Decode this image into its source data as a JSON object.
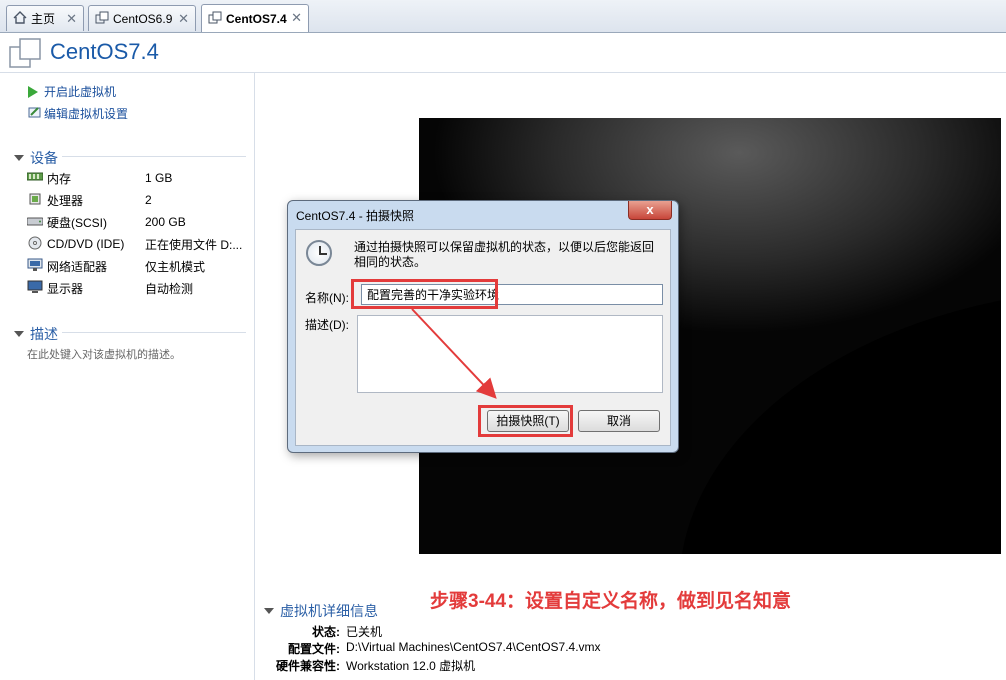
{
  "tabs": [
    {
      "label": "主页",
      "icon": "home-icon"
    },
    {
      "label": "CentOS6.9",
      "icon": "vm-icon"
    },
    {
      "label": "CentOS7.4",
      "icon": "vm-icon",
      "active": true
    }
  ],
  "tab_close_glyph": "✕",
  "header": {
    "title": "CentOS7.4"
  },
  "actions": {
    "power_on": "开启此虚拟机",
    "edit_settings": "编辑虚拟机设置"
  },
  "devices": {
    "section_title": "设备",
    "items": [
      {
        "name": "内存",
        "value": "1 GB",
        "icon": "memory-icon"
      },
      {
        "name": "处理器",
        "value": "2",
        "icon": "cpu-icon"
      },
      {
        "name": "硬盘(SCSI)",
        "value": "200 GB",
        "icon": "harddisk-icon"
      },
      {
        "name": "CD/DVD (IDE)",
        "value": "正在使用文件 D:...",
        "icon": "cdrom-icon"
      },
      {
        "name": "网络适配器",
        "value": "仅主机模式",
        "icon": "network-icon"
      },
      {
        "name": "显示器",
        "value": "自动检测",
        "icon": "display-icon"
      }
    ]
  },
  "description": {
    "section_title": "描述",
    "placeholder": "在此处键入对该虚拟机的描述。"
  },
  "dialog": {
    "title": "CentOS7.4 - 拍摄快照",
    "close_glyph": "x",
    "message": "通过拍摄快照可以保留虚拟机的状态，以便以后您能返回相同的状态。",
    "name_label": "名称(N):",
    "name_value": "配置完善的干净实验环境",
    "desc_label": "描述(D):",
    "take_button": "拍摄快照(T)",
    "cancel_button": "取消"
  },
  "details": {
    "section_title": "虚拟机详细信息",
    "rows": [
      {
        "key": "状态:",
        "value": "已关机"
      },
      {
        "key": "配置文件:",
        "value": "D:\\Virtual Machines\\CentOS7.4\\CentOS7.4.vmx"
      },
      {
        "key": "硬件兼容性:",
        "value": "Workstation 12.0 虚拟机"
      }
    ]
  },
  "caption": "步骤3-44：设置自定义名称，做到见名知意",
  "colors": {
    "accent": "#1a5aa8",
    "highlight": "#e33b3b",
    "play": "#3aa83a"
  }
}
